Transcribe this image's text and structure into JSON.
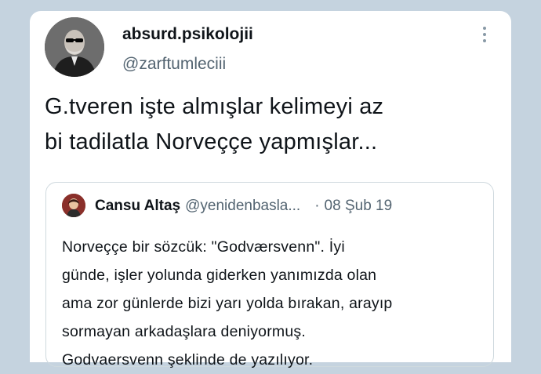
{
  "tweet": {
    "display_name": "absurd.psikolojii",
    "handle": "@zarftumleciii",
    "text_lines": [
      "G.tveren işte almışlar kelimeyi az",
      "bi tadilatla Norveççe yapmışlar..."
    ]
  },
  "quote": {
    "name": "Cansu Altaş",
    "handle": "@yenidenbasla...",
    "separator": "·",
    "date": "08 Şub 19",
    "text_lines": [
      "Norveççe bir sözcük: \"Godværsvenn\". İyi",
      "günde, işler yolunda giderken yanımızda olan",
      "ama zor günlerde bizi yarı yolda bırakan, arayıp",
      "sormayan arkadaşlara deniyormuş.",
      "Godvaersvenn şeklinde de yazılıyor."
    ]
  },
  "icons": {
    "more": "more-vertical-icon"
  },
  "colors": {
    "background": "#c5d3df",
    "card": "#ffffff",
    "primary_text": "#0f1419",
    "secondary_text": "#536471",
    "border": "#cfd9de"
  }
}
